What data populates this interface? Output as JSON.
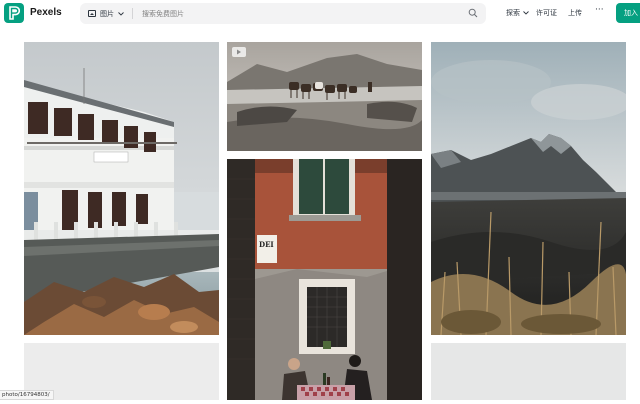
{
  "brand": {
    "name": "Pexels",
    "logo_letter": "P",
    "accent": "#05a081"
  },
  "search": {
    "type_label": "图片",
    "placeholder": "搜索免费图片",
    "value": ""
  },
  "nav": {
    "explore": "探索",
    "license": "许可证",
    "upload": "上传",
    "more": "···",
    "join": "加入"
  },
  "photos": [
    {
      "name": "photo-white-building-seaside"
    },
    {
      "name": "photo-horses-on-beach",
      "video_badge": true
    },
    {
      "name": "photo-mountain-dunes"
    },
    {
      "name": "photo-venice-alley-diners",
      "sign_text": "DEI"
    },
    {
      "name": "photo-bottom-left"
    },
    {
      "name": "photo-bottom-right"
    }
  ],
  "status_url": "photo/16794803/"
}
